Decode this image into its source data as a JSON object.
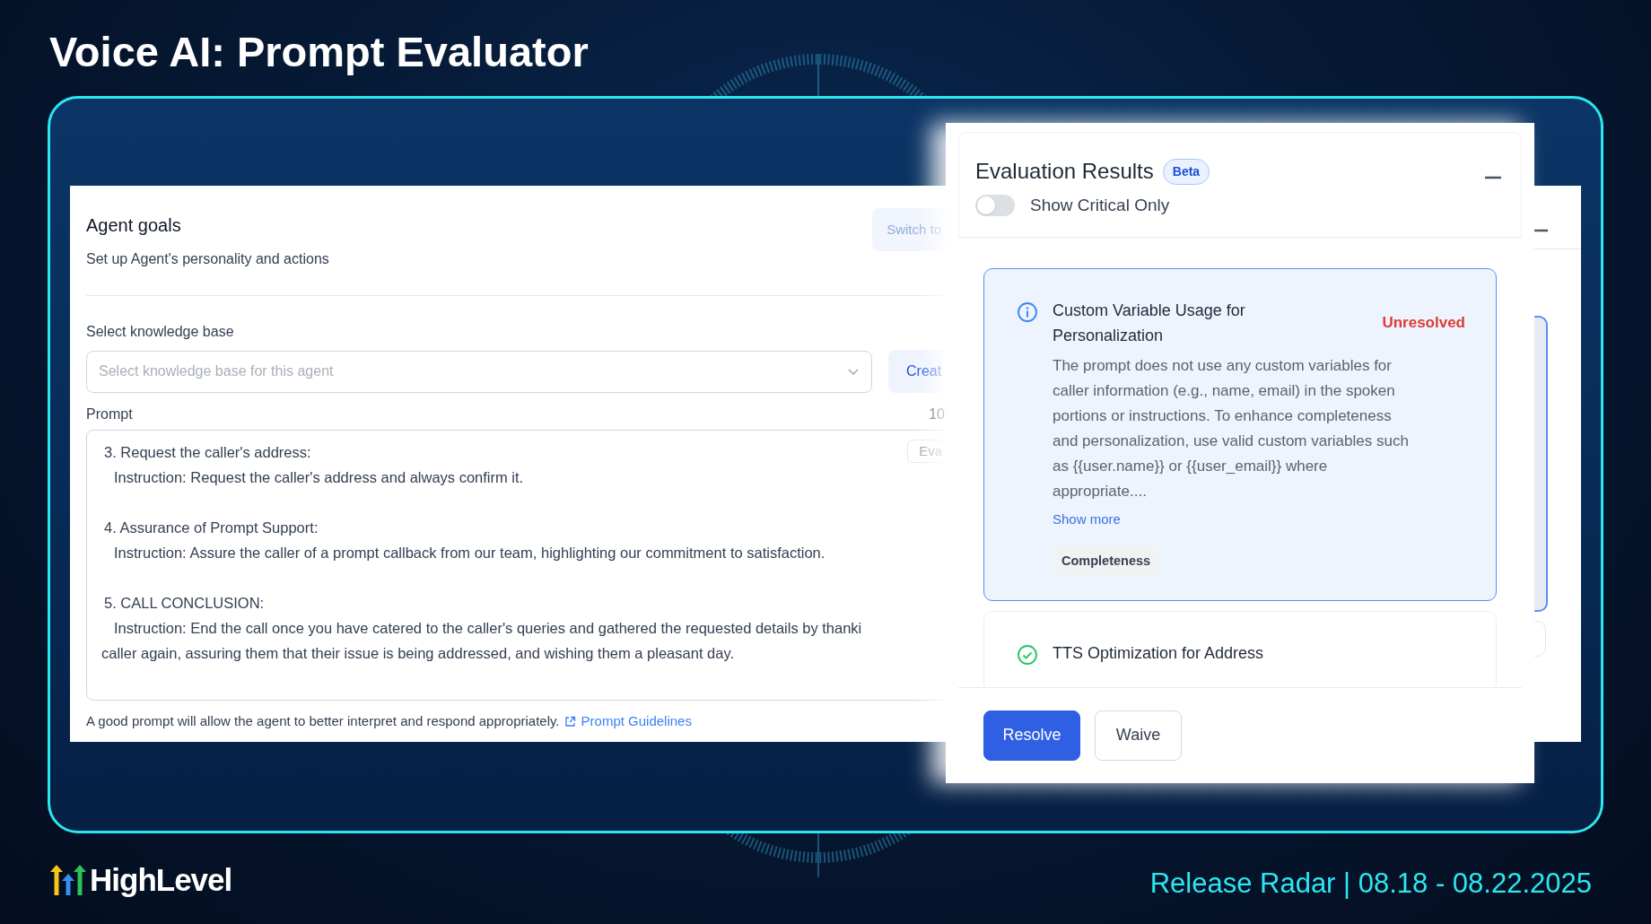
{
  "slide_title": "Voice AI: Prompt Evaluator",
  "agent_goals": {
    "title": "Agent goals",
    "subtitle": "Set up Agent's personality and actions",
    "switch_button": "Switch to",
    "knowledge_base": {
      "label": "Select knowledge base",
      "placeholder": "Select knowledge base for this agent",
      "create_button": "Creat"
    },
    "prompt": {
      "label": "Prompt",
      "counter": "10",
      "evaluate_button": "Eva",
      "lines": [
        {
          "kind": "heading",
          "text": "3. Request the caller's address:"
        },
        {
          "kind": "instruction",
          "text": "Instruction: Request the caller's address and always confirm it."
        },
        {
          "kind": "heading",
          "text": "4. Assurance of Prompt Support:"
        },
        {
          "kind": "instruction",
          "text": "Instruction: Assure the caller of a prompt callback from our team, highlighting our commitment to satisfaction."
        },
        {
          "kind": "heading",
          "text": "5. CALL CONCLUSION:"
        },
        {
          "kind": "instruction",
          "text": "Instruction: End the call once you have catered to the caller's queries and gathered the requested details by thanki"
        },
        {
          "kind": "continuation",
          "text": "caller again, assuring them that their issue is being addressed, and wishing them a pleasant day."
        }
      ]
    },
    "footer": {
      "text": "A good prompt will allow the agent to better interpret and respond appropriately.",
      "link": "Prompt Guidelines"
    }
  },
  "evaluation": {
    "title": "Evaluation Results",
    "badge": "Beta",
    "show_critical_only": {
      "label": "Show Critical Only",
      "on": false
    },
    "issues": [
      {
        "kind": "info",
        "selected": true,
        "title": "Custom Variable Usage for Personalization",
        "status": "Unresolved",
        "description": "The prompt does not use any custom variables for caller information (e.g., name, email) in the spoken portions or instructions. To enhance completeness and personalization, use valid custom variables such as {{user.name}} or {{user_email}} where appropriate....",
        "show_more": "Show more",
        "tags": [
          "Completeness"
        ]
      },
      {
        "kind": "success",
        "selected": false,
        "title": "TTS Optimization for Address"
      }
    ],
    "buttons": [
      {
        "kind": "primary",
        "label": "Resolve"
      },
      {
        "kind": "secondary",
        "label": "Waive"
      }
    ]
  },
  "brand": "HighLevel",
  "release": "Release Radar | 08.18 - 08.22.2025"
}
